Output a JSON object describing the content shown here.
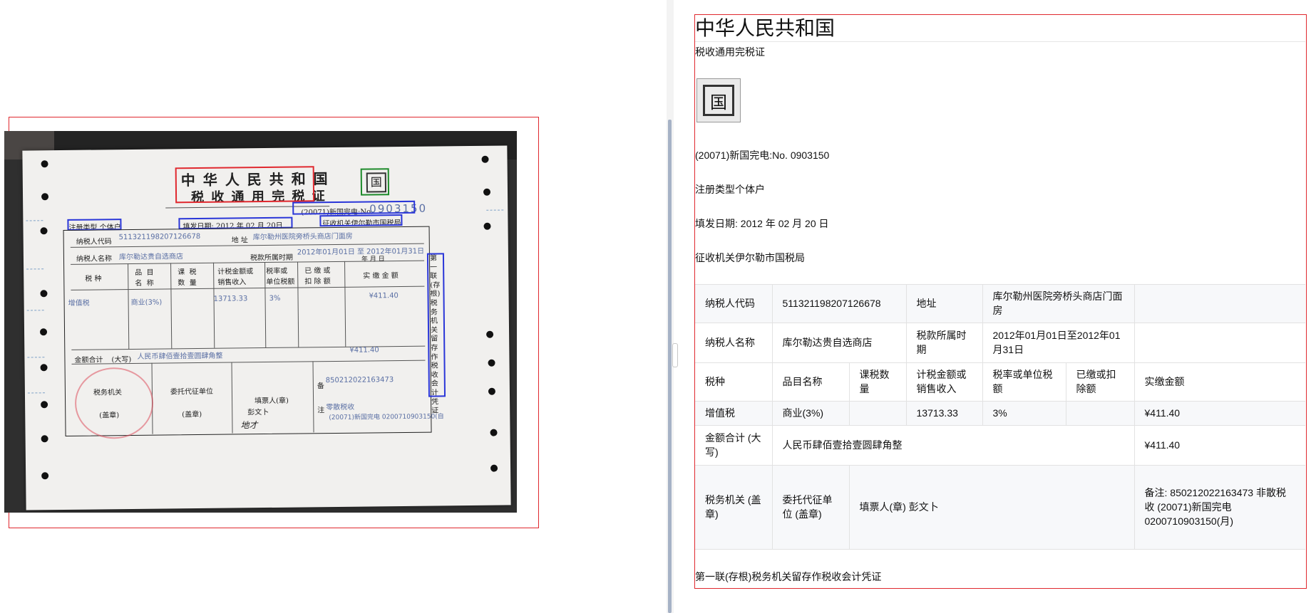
{
  "receipt_photo": {
    "title_line1": "中 华 人 民 共 和 国",
    "title_line2": "税 收 通 用 完 税 证",
    "emblem": "国",
    "serial_prefix": "(20071)新国完电:No.",
    "serial_number": "0903150",
    "reg_type": "注册类型 个体户",
    "fill_date": "填发日期: 2012  年 02 月  20日",
    "collector": "征收机关伊尔勒市国税局",
    "taxpayer_code_label": "纳税人代码",
    "taxpayer_code": "511321198207126678",
    "address_label": "地  址",
    "address": "库尔勒州医院旁桥头商店门面房",
    "taxpayer_name_label": "纳税人名称",
    "taxpayer_name": "库尔勒达贵自选商店",
    "period_label": "税款所属时期",
    "period": "2012年01月01日 至 2012年01月31日",
    "period_hint": "年  月  日",
    "col_tax_type": "税  种",
    "col_item": "品  目\n名  称",
    "col_qty": "课  税\n数  量",
    "col_amount": "计税金额或\n销售收入",
    "col_rate": "税率或\n单位税额",
    "col_paid": "已 缴 或\n扣 除 额",
    "col_actual": "实 缴 金 额",
    "row_tax": "增值税",
    "row_item": "商业(3%)",
    "row_amount": "13713.33",
    "row_rate": "3%",
    "row_actual": "¥411.40",
    "total_label": "金额合计",
    "total_daxie": "(大写)",
    "total_words": "人民币肆佰壹拾壹圆肆角整",
    "total_value": "¥411.40",
    "tax_office": "税务机关",
    "tax_office_seal": "(盖章)",
    "agent": "委托代征单位",
    "agent_seal": "(盖章)",
    "filler": "填票人(章)",
    "filler_name": "彭文卜",
    "note_bei": "备",
    "note_zhu": "注",
    "note_line1": "850212022163473",
    "note_line2": "零散税收",
    "note_line3": "(20071)新国完电 0200710903150(自",
    "side_text": "第一联(存根)税务机关留存作税收会计凭证"
  },
  "transcription": {
    "title": "中华人民共和国",
    "subtitle": "税收通用完税证",
    "emblem": "国",
    "serial": "(20071)新国完电:No. 0903150",
    "reg_type": "注册类型个体户",
    "fill_date": "填发日期: 2012 年 02 月 20 日",
    "collector": "征收机关伊尔勒市国税局",
    "rows": {
      "r1": {
        "c1": "纳税人代码",
        "c2": "511321198207126678",
        "c3": "地址",
        "c4": "库尔勒州医院旁桥头商店门面房"
      },
      "r2": {
        "c1": "纳税人名称",
        "c2": "库尔勒达贵自选商店",
        "c3": "税款所属时期",
        "c4": "2012年01月01日至2012年01月31日"
      },
      "r3": {
        "c1": "税种",
        "c2": "品目名称",
        "c3": "课税数量",
        "c4": "计税金额或销售收入",
        "c5": "税率或单位税额",
        "c6": "已缴或扣除额",
        "c7": "实缴金额"
      },
      "r4": {
        "c1": "增值税",
        "c2": "商业(3%)",
        "c3": "",
        "c4": "13713.33",
        "c5": "3%",
        "c6": "",
        "c7": "¥411.40"
      },
      "r5": {
        "c1": "金额合计 (大写)",
        "c2": "人民币肆佰壹拾壹圆肆角整",
        "c3": "¥411.40"
      },
      "r6": {
        "c1": "税务机关 (盖章)",
        "c2": "委托代征单位 (盖章)",
        "c3": "填票人(章) 彭文卜",
        "c4": "备注: 850212022163473 非散税收 (20071)新国完电 0200710903150(月)"
      }
    },
    "footer": "第一联(存根)税务机关留存作税收会计凭证"
  }
}
